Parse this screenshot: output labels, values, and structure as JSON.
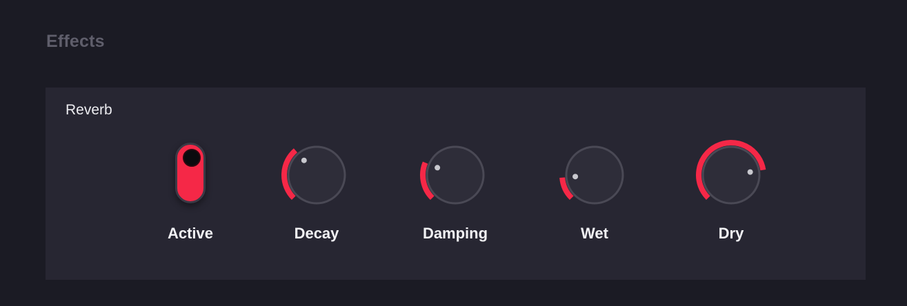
{
  "section": {
    "title": "Effects"
  },
  "reverb": {
    "title": "Reverb",
    "active": {
      "label": "Active",
      "on": true
    },
    "knobs": [
      {
        "key": "decay",
        "label": "Decay",
        "value": 0.35
      },
      {
        "key": "damping",
        "label": "Damping",
        "value": 0.25
      },
      {
        "key": "wet",
        "label": "Wet",
        "value": 0.15
      },
      {
        "key": "dry",
        "label": "Dry",
        "value": 0.8
      }
    ]
  },
  "colors": {
    "accent": "#f52847",
    "panel": "#272632",
    "background": "#1b1b24",
    "knob_track": "#3f3e4a",
    "label": "#f1f1f4",
    "section_title": "#5f5e6b"
  },
  "icons": {
    "toggle_thumb": "toggle-thumb-icon",
    "knob_indicator": "knob-indicator-dot-icon"
  }
}
